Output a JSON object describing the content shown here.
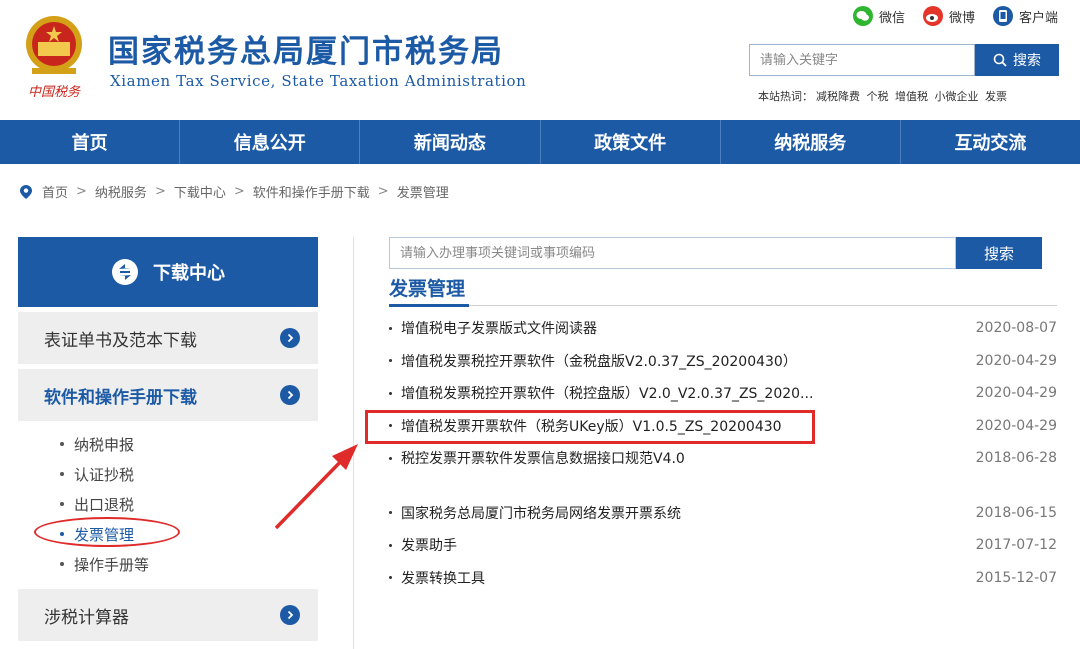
{
  "header": {
    "title": "国家税务总局厦门市税务局",
    "subtitle": "Xiamen Tax Service, State Taxation Administration",
    "social": [
      {
        "label": "微信",
        "icon": "wechat-icon",
        "color": "#2fb52f"
      },
      {
        "label": "微博",
        "icon": "weibo-icon",
        "color": "#e5352a"
      },
      {
        "label": "客户端",
        "icon": "client-app-icon",
        "color": "#1c5aa6"
      }
    ],
    "search": {
      "placeholder": "请输入关键字",
      "button": "搜索"
    },
    "hot_words_label": "本站热词：",
    "hot_words": [
      "减税降费",
      "个税",
      "增值税",
      "小微企业",
      "发票"
    ]
  },
  "nav": [
    "首页",
    "信息公开",
    "新闻动态",
    "政策文件",
    "纳税服务",
    "互动交流"
  ],
  "breadcrumb": [
    "首页",
    "纳税服务",
    "下载中心",
    "软件和操作手册下载",
    "发票管理"
  ],
  "sidebar": {
    "title": "下载中心",
    "categories": [
      {
        "label": "表证单书及范本下载"
      },
      {
        "label": "软件和操作手册下载"
      },
      {
        "label": "涉税计算器"
      }
    ],
    "subitems": [
      "纳税申报",
      "认证抄税",
      "出口退税",
      "发票管理",
      "操作手册等"
    ]
  },
  "main": {
    "search": {
      "placeholder": "请输入办理事项关键词或事项编码",
      "button": "搜索"
    },
    "section_title": "发票管理",
    "files": [
      {
        "name": "增值税电子发票版式文件阅读器",
        "date": "2020-08-07"
      },
      {
        "name": "增值税发票税控开票软件（金税盘版V2.0.37_ZS_20200430）",
        "date": "2020-04-29"
      },
      {
        "name": "增值税发票税控开票软件（税控盘版）V2.0_V2.0.37_ZS_2020...",
        "date": "2020-04-29"
      },
      {
        "name": "增值税发票开票软件（税务UKey版）V1.0.5_ZS_20200430",
        "date": "2020-04-29"
      },
      {
        "name": "税控发票开票软件发票信息数据接口规范V4.0",
        "date": "2018-06-28"
      },
      {
        "name": "国家税务总局厦门市税务局网络发票开票系统",
        "date": "2018-06-15"
      },
      {
        "name": "发票助手",
        "date": "2017-07-12"
      },
      {
        "name": "发票转换工具",
        "date": "2015-12-07"
      }
    ]
  },
  "colors": {
    "brand": "#1c5aa6",
    "annotation": "#e02b2b"
  }
}
